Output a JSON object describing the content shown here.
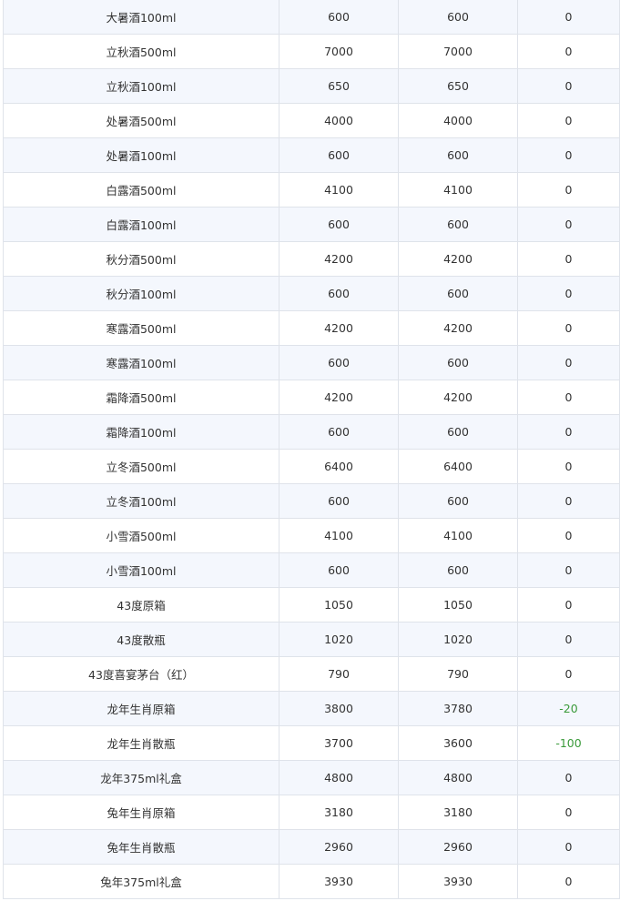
{
  "table": {
    "rows": [
      {
        "name": "大暑酒100ml",
        "v1": "600",
        "v2": "600",
        "diff": "0"
      },
      {
        "name": "立秋酒500ml",
        "v1": "7000",
        "v2": "7000",
        "diff": "0"
      },
      {
        "name": "立秋酒100ml",
        "v1": "650",
        "v2": "650",
        "diff": "0"
      },
      {
        "name": "处暑酒500ml",
        "v1": "4000",
        "v2": "4000",
        "diff": "0"
      },
      {
        "name": "处暑酒100ml",
        "v1": "600",
        "v2": "600",
        "diff": "0"
      },
      {
        "name": "白露酒500ml",
        "v1": "4100",
        "v2": "4100",
        "diff": "0"
      },
      {
        "name": "白露酒100ml",
        "v1": "600",
        "v2": "600",
        "diff": "0"
      },
      {
        "name": "秋分酒500ml",
        "v1": "4200",
        "v2": "4200",
        "diff": "0"
      },
      {
        "name": "秋分酒100ml",
        "v1": "600",
        "v2": "600",
        "diff": "0"
      },
      {
        "name": "寒露酒500ml",
        "v1": "4200",
        "v2": "4200",
        "diff": "0"
      },
      {
        "name": "寒露酒100ml",
        "v1": "600",
        "v2": "600",
        "diff": "0"
      },
      {
        "name": "霜降酒500ml",
        "v1": "4200",
        "v2": "4200",
        "diff": "0"
      },
      {
        "name": "霜降酒100ml",
        "v1": "600",
        "v2": "600",
        "diff": "0"
      },
      {
        "name": "立冬酒500ml",
        "v1": "6400",
        "v2": "6400",
        "diff": "0"
      },
      {
        "name": "立冬酒100ml",
        "v1": "600",
        "v2": "600",
        "diff": "0"
      },
      {
        "name": "小雪酒500ml",
        "v1": "4100",
        "v2": "4100",
        "diff": "0"
      },
      {
        "name": "小雪酒100ml",
        "v1": "600",
        "v2": "600",
        "diff": "0"
      },
      {
        "name": "43度原箱",
        "v1": "1050",
        "v2": "1050",
        "diff": "0"
      },
      {
        "name": "43度散瓶",
        "v1": "1020",
        "v2": "1020",
        "diff": "0"
      },
      {
        "name": "43度喜宴茅台（红）",
        "v1": "790",
        "v2": "790",
        "diff": "0"
      },
      {
        "name": "龙年生肖原箱",
        "v1": "3800",
        "v2": "3780",
        "diff": "-20"
      },
      {
        "name": "龙年生肖散瓶",
        "v1": "3700",
        "v2": "3600",
        "diff": "-100"
      },
      {
        "name": "龙年375ml礼盒",
        "v1": "4800",
        "v2": "4800",
        "diff": "0"
      },
      {
        "name": "兔年生肖原箱",
        "v1": "3180",
        "v2": "3180",
        "diff": "0"
      },
      {
        "name": "兔年生肖散瓶",
        "v1": "2960",
        "v2": "2960",
        "diff": "0"
      },
      {
        "name": "兔年375ml礼盒",
        "v1": "3930",
        "v2": "3930",
        "diff": "0"
      }
    ],
    "colors": {
      "row_alt_bg": "#f4f7fd",
      "border": "#dfe3ea",
      "text": "#333333",
      "negative_text": "#3a9a3a"
    }
  }
}
